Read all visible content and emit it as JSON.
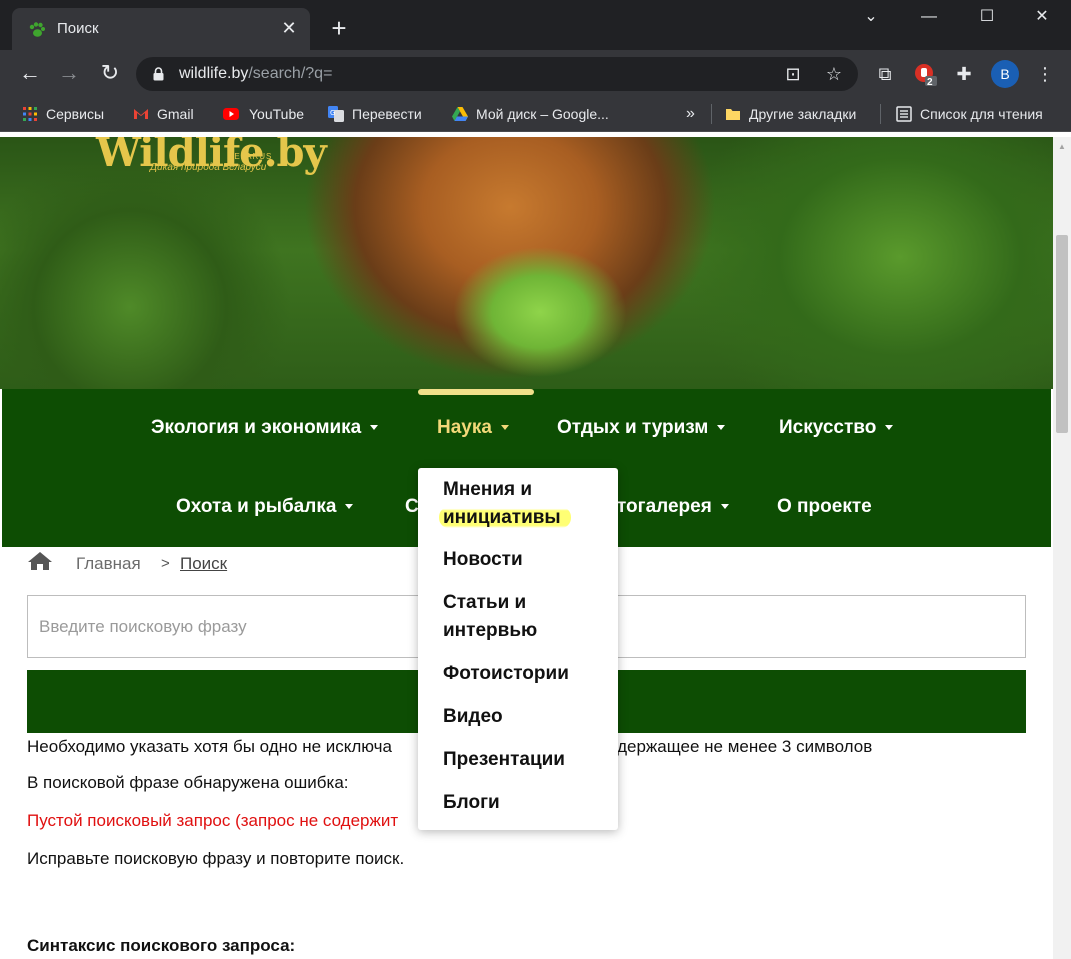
{
  "browser": {
    "tab_title": "Поиск",
    "new_tab_symbol": "+",
    "url_host": "wildlife.by",
    "url_path": "/search/?q=",
    "profile_initial": "B",
    "extension_badge": "2"
  },
  "bookmarks": {
    "items": [
      {
        "label": "Сервисы",
        "icon": "apps-grid-icon"
      },
      {
        "label": "Gmail",
        "icon": "gmail-icon"
      },
      {
        "label": "YouTube",
        "icon": "youtube-icon"
      },
      {
        "label": "Перевести",
        "icon": "translate-icon"
      },
      {
        "label": "Мой диск – Google...",
        "icon": "google-drive-icon"
      }
    ],
    "overflow": "»",
    "other": "Другие закладки",
    "reading_list": "Список для чтения"
  },
  "site": {
    "logo_text": "Wildlife.by",
    "logo_country": "BELARUS",
    "logo_tagline": "Дикая природа Беларуси"
  },
  "nav": {
    "row1": [
      "Экология и экономика",
      "Наука",
      "Отдых и туризм",
      "Искусство"
    ],
    "row2": [
      "Охота и рыбалка",
      "С",
      "тогалерея",
      "О проекте"
    ],
    "active": "Наука"
  },
  "dropdown": {
    "item1_line1": "Мнения и",
    "item1_line2": "инициативы",
    "item2": "Новости",
    "item3_line1": "Статьи и",
    "item3_line2": "интервью",
    "item4": "Фотоистории",
    "item5": "Видео",
    "item6": "Презентации",
    "item7": "Блоги"
  },
  "breadcrumb": {
    "home": "Главная",
    "separator": ">",
    "current": "Поиск"
  },
  "search": {
    "placeholder": "Введите поисковую фразу",
    "value": ""
  },
  "messages": {
    "line1_left": "Необходимо указать хотя бы одно не исключа",
    "line1_right": "одержащее не менее 3 символов",
    "line2": "В поисковой фразе обнаружена ошибка:",
    "line3": "Пустой поисковый запрос (запрос не содержит",
    "line4": "Исправьте поисковую фразу и повторите поиск.",
    "syntax_heading": "Синтаксис поискового запроса:"
  },
  "colors": {
    "nav_green": "#0d4d03",
    "active_yellow": "#f2d879",
    "error_red": "#e01010",
    "highlight_yellow": "#ffff74"
  }
}
